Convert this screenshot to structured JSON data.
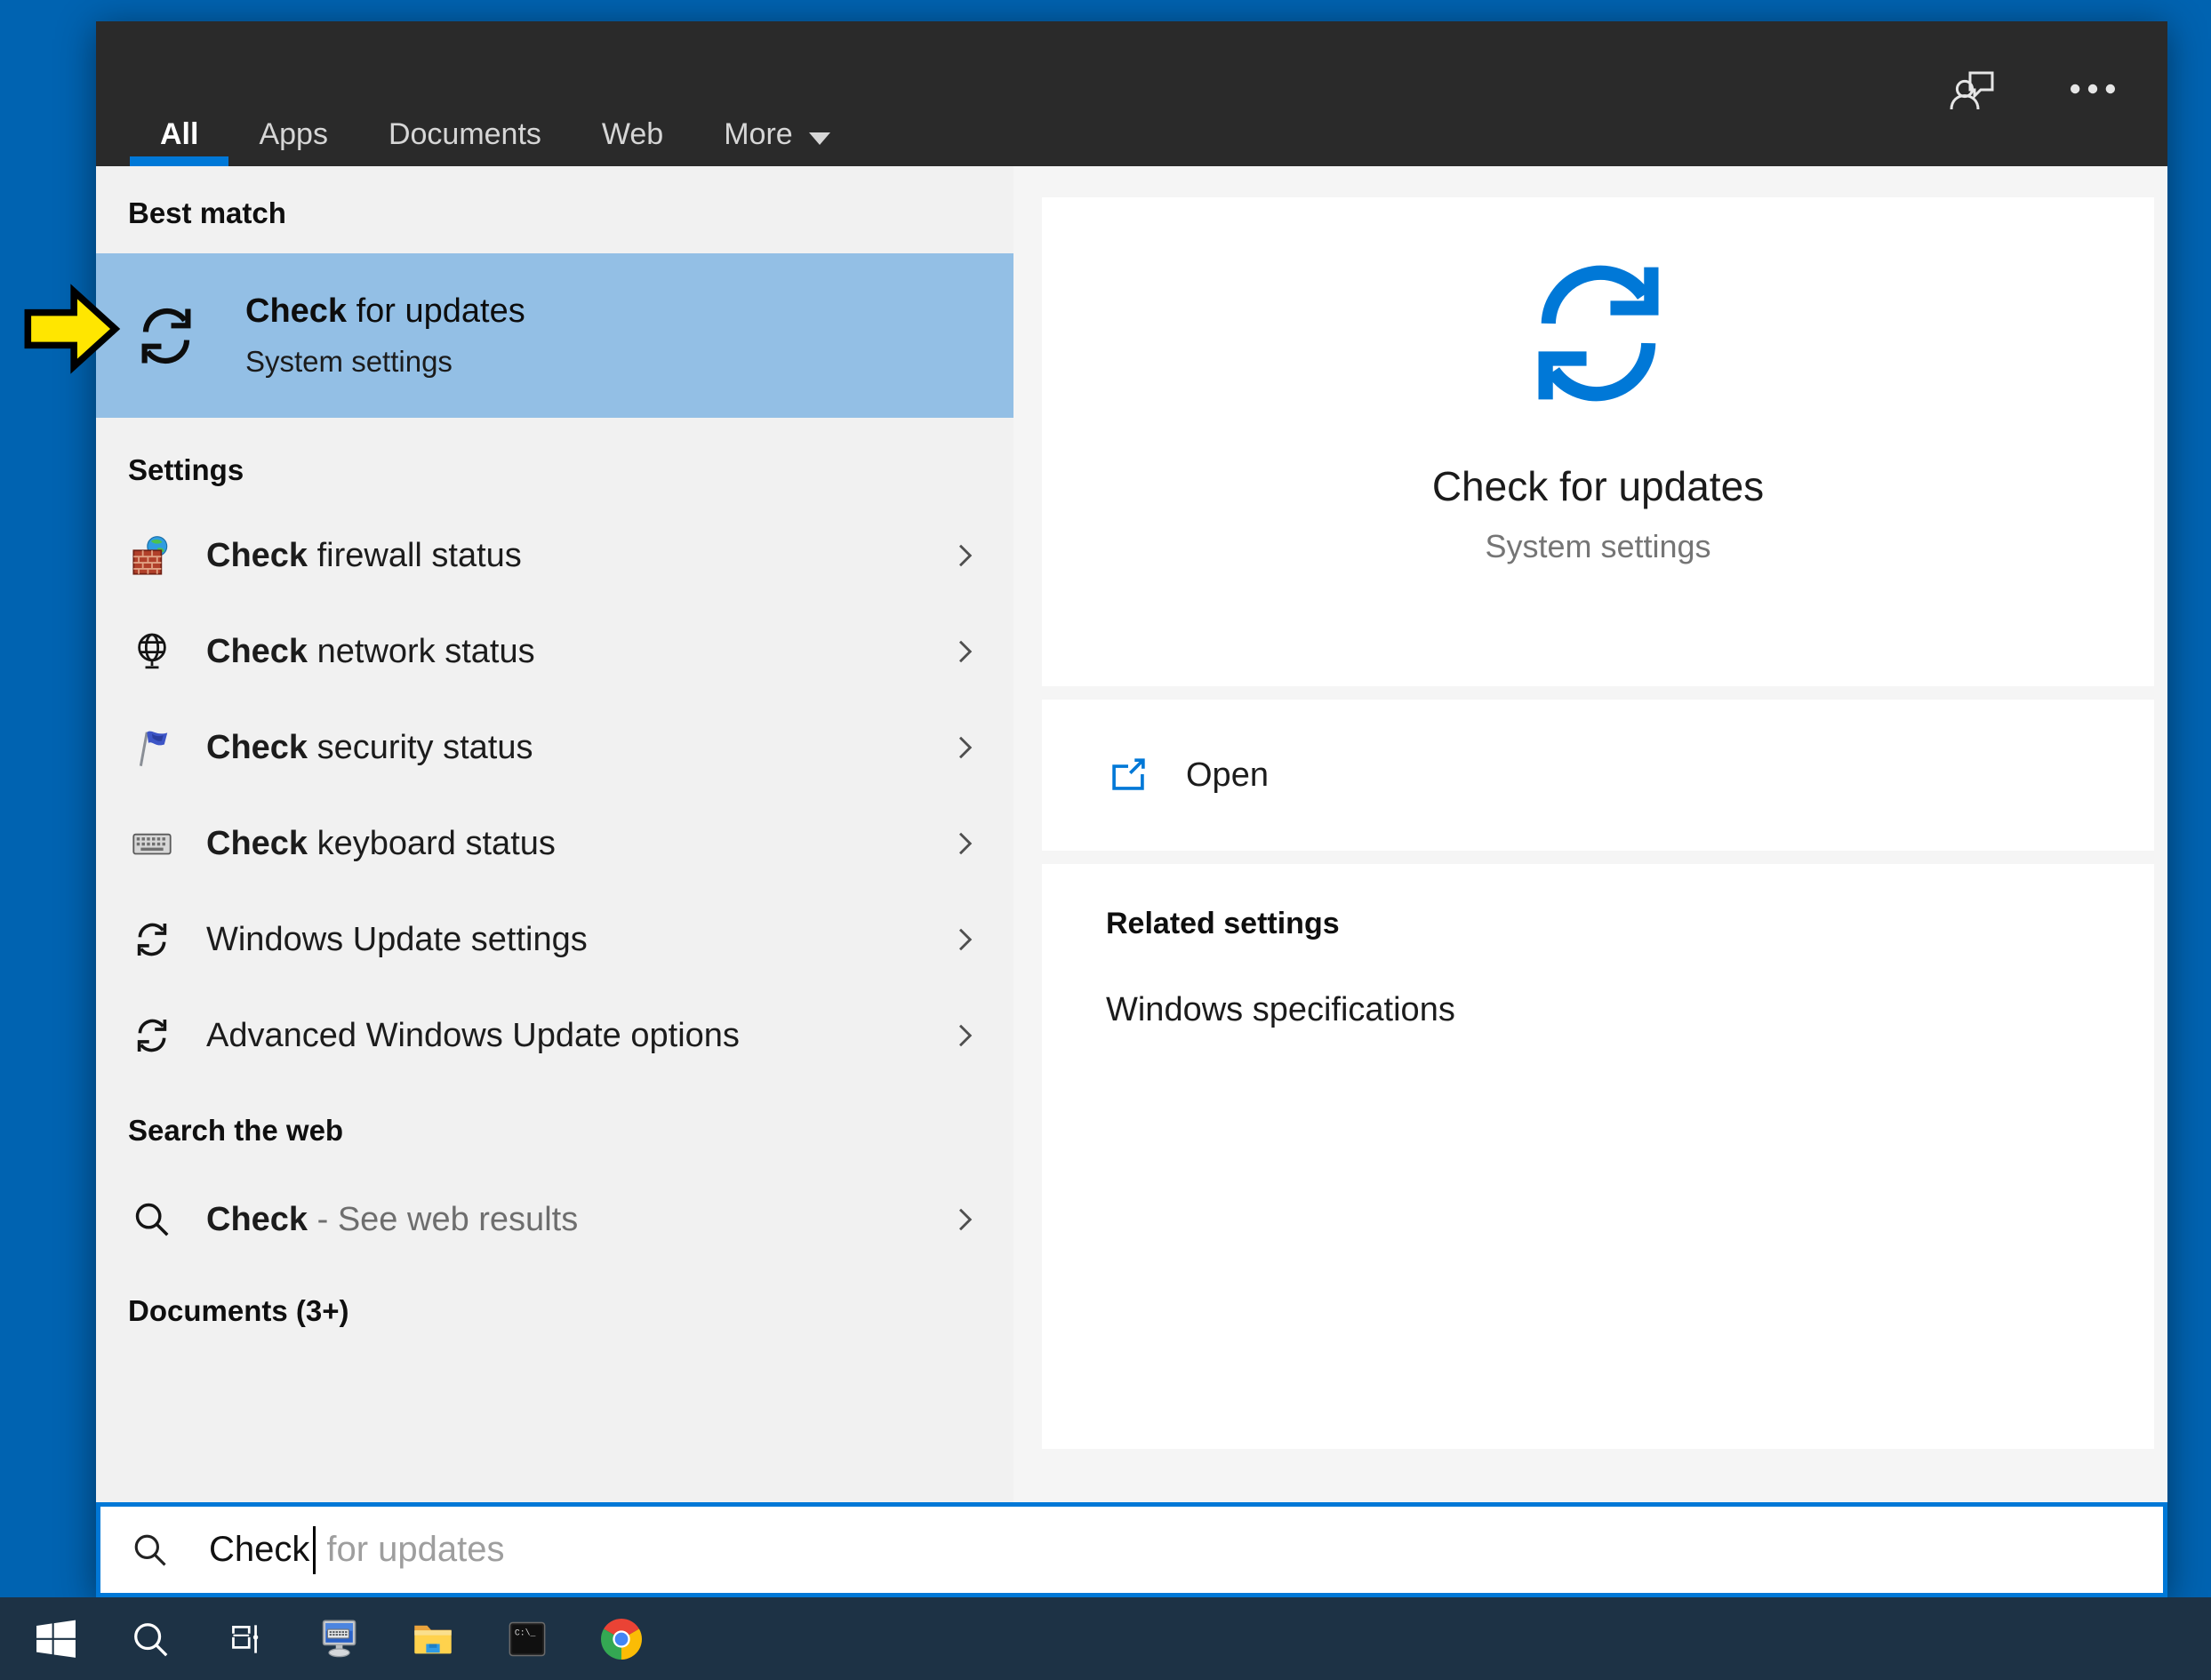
{
  "topbar": {
    "tabs": [
      {
        "label": "All"
      },
      {
        "label": "Apps"
      },
      {
        "label": "Documents"
      },
      {
        "label": "Web"
      },
      {
        "label": "More"
      }
    ],
    "active_tab": "All",
    "icons": {
      "user": "user-feedback-icon",
      "more": "ellipsis-icon"
    }
  },
  "left_panel": {
    "best_match": {
      "header": "Best match",
      "title_lead": "Check",
      "title_rest": " for updates",
      "subtitle": "System settings",
      "icon": "sync-icon"
    },
    "settings": {
      "header": "Settings",
      "items": [
        {
          "lead": "Check",
          "rest": " firewall status",
          "icon": "firewall-icon"
        },
        {
          "lead": "Check",
          "rest": " network status",
          "icon": "network-globe-icon"
        },
        {
          "lead": "Check",
          "rest": " security status",
          "icon": "security-flag-icon"
        },
        {
          "lead": "Check",
          "rest": " keyboard status",
          "icon": "keyboard-icon"
        },
        {
          "lead": "",
          "rest": "Windows Update settings",
          "icon": "sync-icon"
        },
        {
          "lead": "",
          "rest": "Advanced Windows Update options",
          "icon": "sync-icon"
        }
      ]
    },
    "web": {
      "header": "Search the web",
      "item_lead": "Check",
      "item_rest": " - See web results",
      "icon": "search-icon"
    },
    "documents": {
      "header": "Documents (3+)"
    }
  },
  "preview_panel": {
    "icon": "sync-icon",
    "title": "Check for updates",
    "subtitle": "System settings",
    "open_label": "Open",
    "related": {
      "header": "Related settings",
      "items": [
        {
          "label": "Windows specifications"
        }
      ]
    }
  },
  "search_box": {
    "value": "Check",
    "suggestion": "for updates",
    "icon": "search-icon"
  },
  "taskbar": {
    "icons": [
      {
        "name": "start-button"
      },
      {
        "name": "search-button"
      },
      {
        "name": "task-view-button"
      },
      {
        "name": "remote-desktop-app"
      },
      {
        "name": "file-explorer-app"
      },
      {
        "name": "command-prompt-app"
      },
      {
        "name": "chrome-app"
      }
    ]
  },
  "colors": {
    "accent": "#0078d7",
    "desktop": "#0063b1",
    "highlight": "#93bfe5",
    "taskbar": "#1d3245",
    "topbar": "#2a2a2a",
    "panel_gray": "#f1f1f1",
    "arrow_yellow": "#ffe600"
  }
}
